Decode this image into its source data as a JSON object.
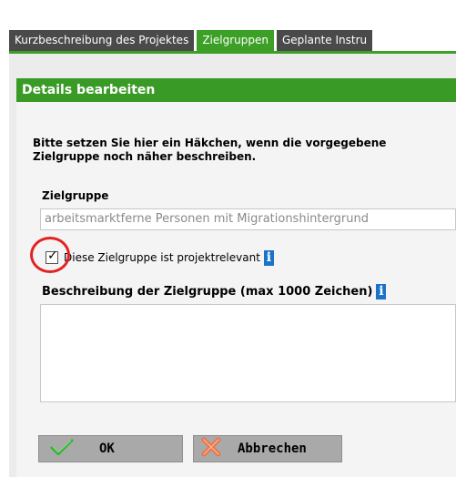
{
  "tabs": [
    {
      "label": "Kurzbeschreibung des Projektes",
      "active": false
    },
    {
      "label": "Zielgruppen",
      "active": true
    },
    {
      "label": "Geplante Instru",
      "active": false
    }
  ],
  "panel": {
    "title": "Details bearbeiten",
    "intro_line1": "Bitte setzen Sie hier ein Häkchen, wenn die vorgegebene",
    "intro_line2": "Zielgruppe noch näher beschreiben."
  },
  "zielgruppe": {
    "label": "Zielgruppe",
    "value": "arbeitsmarktferne Personen mit Migrationshintergrund"
  },
  "relevant": {
    "checked": true,
    "label": "Diese Zielgruppe ist projektrelevant",
    "info_icon": "info-icon"
  },
  "beschreibung": {
    "label": "Beschreibung der Zielgruppe (max 1000 Zeichen)",
    "value": "",
    "info_icon": "info-icon"
  },
  "buttons": {
    "ok": "OK",
    "cancel": "Abbrechen"
  },
  "colors": {
    "accent_green": "#3c9f26",
    "tab_dark": "#4a4a4a",
    "highlight_red": "#e32222",
    "info_blue": "#1a72c9"
  }
}
